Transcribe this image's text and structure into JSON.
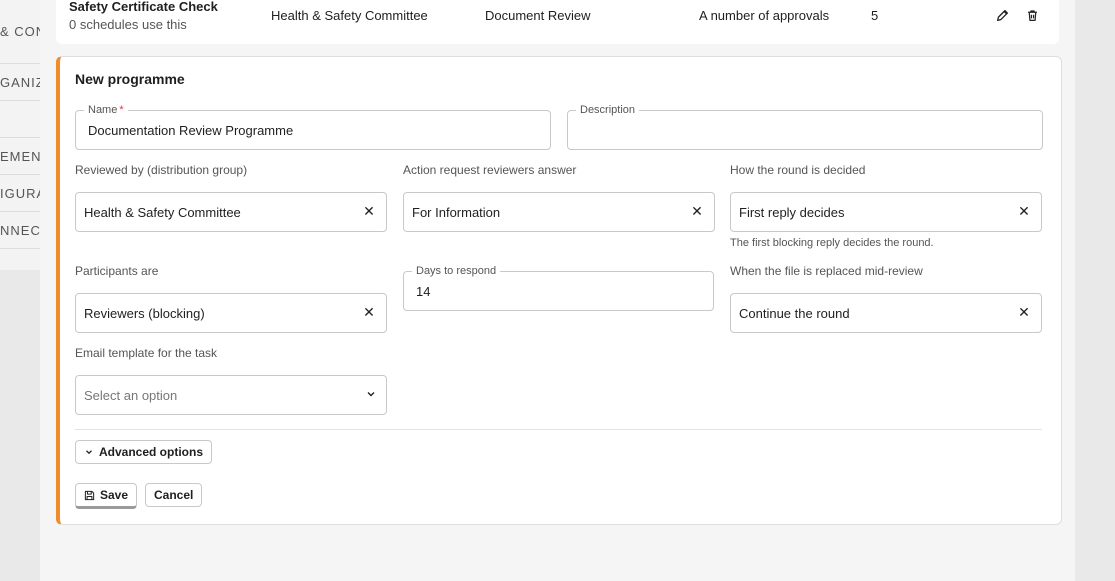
{
  "bg_nav": [
    "& CON",
    "GANIZ",
    "",
    "EMENT",
    "IGURA",
    "NNECT",
    ""
  ],
  "existing_row": {
    "title": "Safety Certificate Check",
    "subtitle": "0 schedules use this",
    "group": "Health & Safety Committee",
    "type": "Document Review",
    "approval": "A number of approvals",
    "count": "5"
  },
  "form": {
    "title": "New programme",
    "name_label": "Name",
    "name_required": "*",
    "name_value": "Documentation Review Programme",
    "description_label": "Description",
    "description_value": "",
    "reviewed_by_label": "Reviewed by (distribution group)",
    "reviewed_by_value": "Health & Safety Committee",
    "action_label": "Action request reviewers answer",
    "action_value": "For Information",
    "round_label": "How the round is decided",
    "round_value": "First reply decides",
    "round_hint": "The first blocking reply decides the round.",
    "participants_label": "Participants are",
    "participants_value": "Reviewers (blocking)",
    "days_label": "Days to respond",
    "days_value": "14",
    "replaced_label": "When the file is replaced mid-review",
    "replaced_value": "Continue the round",
    "email_label": "Email template for the task",
    "email_placeholder": "Select an option",
    "advanced_label": "Advanced options",
    "save_label": "Save",
    "cancel_label": "Cancel"
  },
  "colors": {
    "accent": "#f08c2a",
    "required": "#e0314b"
  },
  "icons": {
    "edit": "pencil-icon",
    "delete": "trash-icon",
    "clear": "close-icon",
    "chevron": "chevron-down-icon",
    "save": "floppy-disk-icon"
  }
}
